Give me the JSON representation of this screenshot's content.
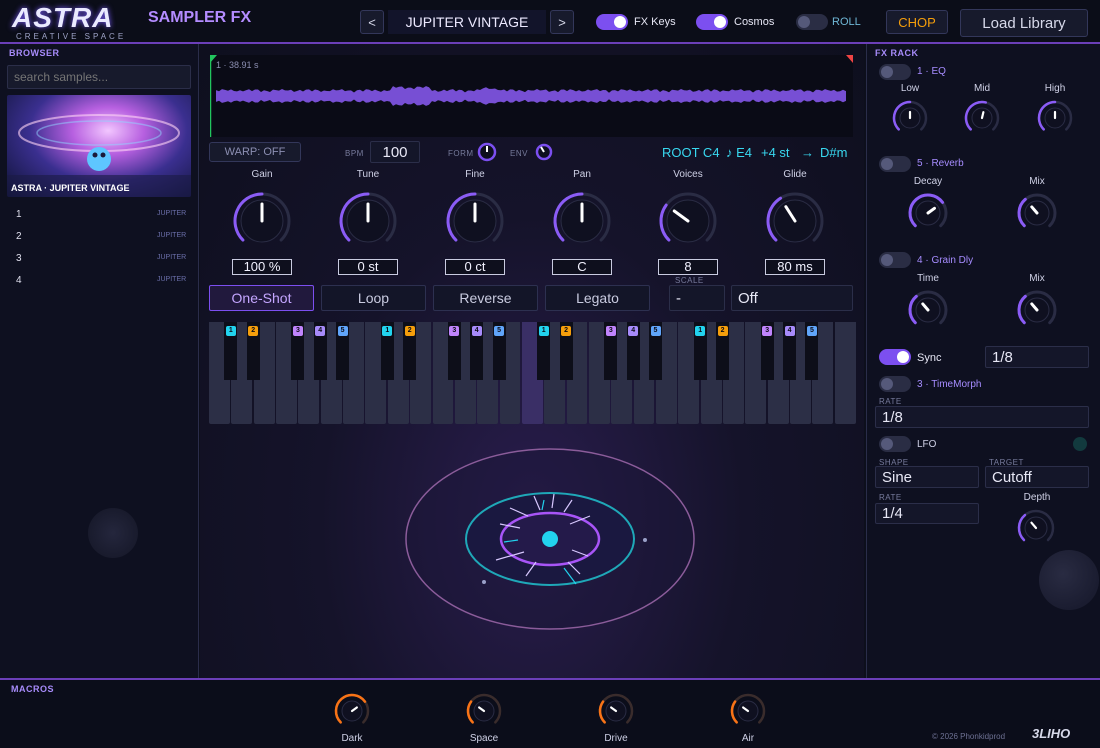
{
  "header": {
    "logo_title": "ASTRA",
    "logo_subtitle": "CREATIVE SPACE",
    "app_title": "SAMPLER FX",
    "prev_label": "<",
    "next_label": ">",
    "preset_name": "JUPITER VINTAGE",
    "fx_keys_label": "FX Keys",
    "cosmos_label": "Cosmos",
    "roll_label": "ROLL",
    "chop_label": "CHOP",
    "load_library_label": "Load Library"
  },
  "browser": {
    "title": "BROWSER",
    "search_placeholder": "search samples...",
    "preview_caption": "ASTRA · JUPITER VINTAGE",
    "items": [
      {
        "index": "1",
        "tag": "JUPITER"
      },
      {
        "index": "2",
        "tag": "JUPITER"
      },
      {
        "index": "3",
        "tag": "JUPITER"
      },
      {
        "index": "4",
        "tag": "JUPITER"
      }
    ]
  },
  "waveform": {
    "info": "1 · 38.91 s"
  },
  "transport": {
    "warp_label": "WARP: OFF",
    "bpm_label": "BPM",
    "bpm_value": "100",
    "form_label": "FORM",
    "env_label": "ENV",
    "root_label": "ROOT C4",
    "note_label": "♪ E4",
    "semitone_label": "+4 st",
    "arrow": "→",
    "key_label": "D#m"
  },
  "knobs": [
    {
      "label": "Gain",
      "value": "100 %",
      "level": 0.5
    },
    {
      "label": "Tune",
      "value": "0 st",
      "level": 0.5
    },
    {
      "label": "Fine",
      "value": "0 ct",
      "level": 0.5
    },
    {
      "label": "Pan",
      "value": "C",
      "level": 0.5
    },
    {
      "label": "Voices",
      "value": "8",
      "level": 0.3
    },
    {
      "label": "Glide",
      "value": "80 ms",
      "level": 0.38
    }
  ],
  "modes": {
    "one_shot": "One-Shot",
    "loop": "Loop",
    "reverse": "Reverse",
    "legato": "Legato",
    "scale_label": "SCALE",
    "scale_value": "-",
    "scale_mode": "Off"
  },
  "keyboard": {
    "badges": [
      "1",
      "2",
      "3",
      "4",
      "5"
    ],
    "octaves": 3
  },
  "fx_rack": {
    "title": "FX RACK",
    "eq": {
      "title": "1 · EQ",
      "knobs": [
        {
          "label": "Low",
          "level": 0.5
        },
        {
          "label": "Mid",
          "level": 0.55
        },
        {
          "label": "High",
          "level": 0.5
        }
      ]
    },
    "reverb": {
      "title": "5 · Reverb",
      "knobs": [
        {
          "label": "Decay",
          "level": 0.7
        },
        {
          "label": "Mix",
          "level": 0.35
        }
      ]
    },
    "grain": {
      "title": "4 · Grain Dly",
      "knobs": [
        {
          "label": "Time",
          "level": 0.35
        },
        {
          "label": "Mix",
          "level": 0.35
        }
      ]
    },
    "sync_label": "Sync",
    "sync_value": "1/8",
    "timemorph": {
      "title": "3 · TimeMorph",
      "rate_label": "RATE",
      "rate_value": "1/8"
    },
    "lfo": {
      "title": "LFO",
      "shape_label": "SHAPE",
      "shape_value": "Sine",
      "target_label": "TARGET",
      "target_value": "Cutoff",
      "rate_label": "RATE",
      "rate_value": "1/4",
      "depth_label": "Depth",
      "depth_level": 0.35
    }
  },
  "macros": {
    "title": "MACROS",
    "knobs": [
      {
        "label": "Dark",
        "level": 0.7
      },
      {
        "label": "Space",
        "level": 0.3
      },
      {
        "label": "Drive",
        "level": 0.3
      },
      {
        "label": "Air",
        "level": 0.3
      }
    ],
    "copyright": "© 2026 Phonkidprod",
    "brand_mark": "3LIHO"
  },
  "colors": {
    "accent": "#7c4ff0",
    "accent_light": "#b48cff",
    "cyan": "#22d3ee",
    "orange": "#f59e0b",
    "macro_ring": "#f97316"
  }
}
